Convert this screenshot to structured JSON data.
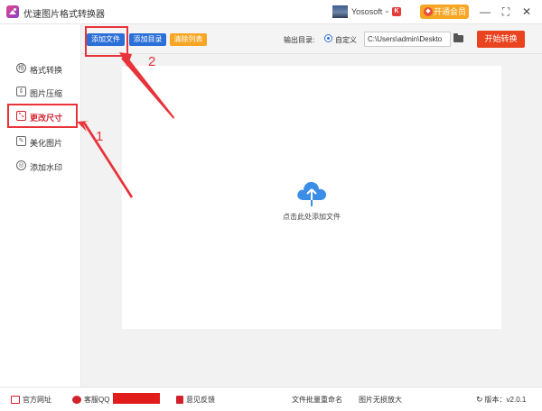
{
  "window": {
    "title": "优速图片格式转换器",
    "user_name": "Yososoft",
    "user_badge": "K",
    "vip_label": "开通会员",
    "minimize": "—",
    "maximize": "⛶",
    "close": "✕"
  },
  "toolbar": {
    "add_file": "添加文件",
    "add_folder": "添加目录",
    "clear_list": "清除列表",
    "output_dir_label": "输出目录:",
    "custom_label": "自定义",
    "output_path": "C:\\Users\\admin\\Deskto",
    "start_label": "开始转换"
  },
  "sidebar": {
    "items": [
      {
        "label": "格式转换",
        "icon": "格"
      },
      {
        "label": "图片压缩",
        "icon": "⇕"
      },
      {
        "label": "更改尺寸",
        "icon": "⤡"
      },
      {
        "label": "美化图片",
        "icon": "✎"
      },
      {
        "label": "添加水印",
        "icon": "◎"
      }
    ],
    "active_index": 2
  },
  "main": {
    "drop_text": "点击此处添加文件"
  },
  "annotations": {
    "step1": "1",
    "step2": "2"
  },
  "footer": {
    "website": "官方网址",
    "qq": "客服QQ",
    "feedback": "意见反馈",
    "batch_rename": "文件批量重命名",
    "lossless": "图片无损放大",
    "version": "版本：v2.0.1"
  },
  "colors": {
    "add_file": "#2b6fd8",
    "add_folder": "#2b6fd8",
    "clear_list": "#f6a623",
    "start": "#e9431f",
    "accent_red": "#d3212b",
    "annotation": "#e8333a",
    "cloud": "#3a8ee6"
  }
}
